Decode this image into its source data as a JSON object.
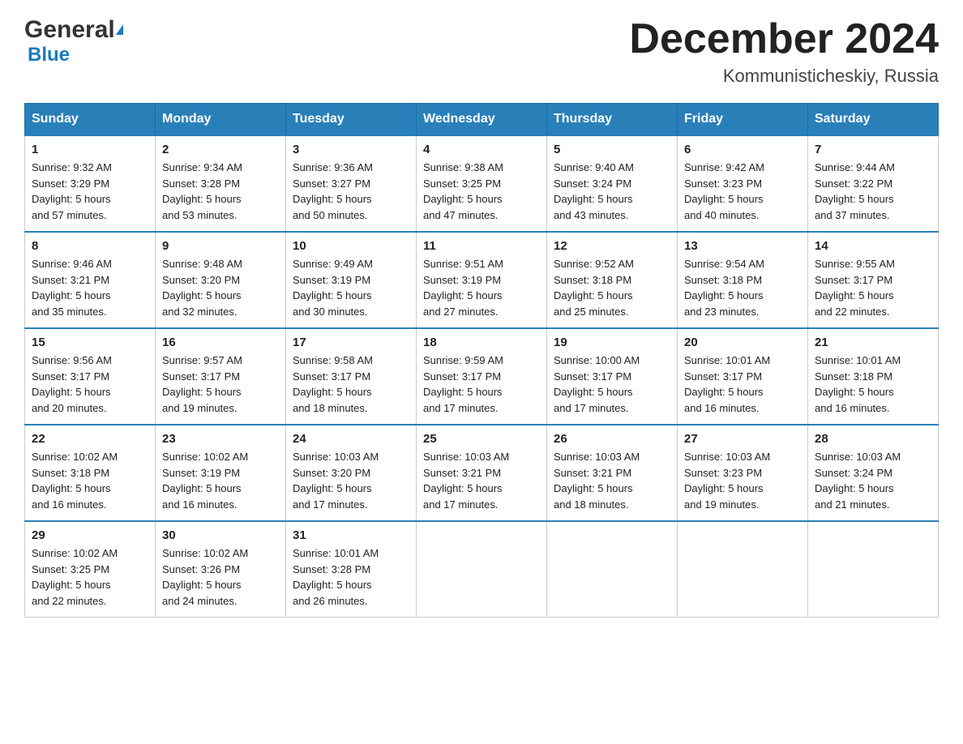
{
  "header": {
    "logo": {
      "general": "General",
      "blue": "Blue"
    },
    "title": "December 2024",
    "location": "Kommunisticheskiy, Russia"
  },
  "weekdays": [
    "Sunday",
    "Monday",
    "Tuesday",
    "Wednesday",
    "Thursday",
    "Friday",
    "Saturday"
  ],
  "weeks": [
    [
      {
        "day": "1",
        "sunrise": "9:32 AM",
        "sunset": "3:29 PM",
        "daylight": "5 hours and 57 minutes."
      },
      {
        "day": "2",
        "sunrise": "9:34 AM",
        "sunset": "3:28 PM",
        "daylight": "5 hours and 53 minutes."
      },
      {
        "day": "3",
        "sunrise": "9:36 AM",
        "sunset": "3:27 PM",
        "daylight": "5 hours and 50 minutes."
      },
      {
        "day": "4",
        "sunrise": "9:38 AM",
        "sunset": "3:25 PM",
        "daylight": "5 hours and 47 minutes."
      },
      {
        "day": "5",
        "sunrise": "9:40 AM",
        "sunset": "3:24 PM",
        "daylight": "5 hours and 43 minutes."
      },
      {
        "day": "6",
        "sunrise": "9:42 AM",
        "sunset": "3:23 PM",
        "daylight": "5 hours and 40 minutes."
      },
      {
        "day": "7",
        "sunrise": "9:44 AM",
        "sunset": "3:22 PM",
        "daylight": "5 hours and 37 minutes."
      }
    ],
    [
      {
        "day": "8",
        "sunrise": "9:46 AM",
        "sunset": "3:21 PM",
        "daylight": "5 hours and 35 minutes."
      },
      {
        "day": "9",
        "sunrise": "9:48 AM",
        "sunset": "3:20 PM",
        "daylight": "5 hours and 32 minutes."
      },
      {
        "day": "10",
        "sunrise": "9:49 AM",
        "sunset": "3:19 PM",
        "daylight": "5 hours and 30 minutes."
      },
      {
        "day": "11",
        "sunrise": "9:51 AM",
        "sunset": "3:19 PM",
        "daylight": "5 hours and 27 minutes."
      },
      {
        "day": "12",
        "sunrise": "9:52 AM",
        "sunset": "3:18 PM",
        "daylight": "5 hours and 25 minutes."
      },
      {
        "day": "13",
        "sunrise": "9:54 AM",
        "sunset": "3:18 PM",
        "daylight": "5 hours and 23 minutes."
      },
      {
        "day": "14",
        "sunrise": "9:55 AM",
        "sunset": "3:17 PM",
        "daylight": "5 hours and 22 minutes."
      }
    ],
    [
      {
        "day": "15",
        "sunrise": "9:56 AM",
        "sunset": "3:17 PM",
        "daylight": "5 hours and 20 minutes."
      },
      {
        "day": "16",
        "sunrise": "9:57 AM",
        "sunset": "3:17 PM",
        "daylight": "5 hours and 19 minutes."
      },
      {
        "day": "17",
        "sunrise": "9:58 AM",
        "sunset": "3:17 PM",
        "daylight": "5 hours and 18 minutes."
      },
      {
        "day": "18",
        "sunrise": "9:59 AM",
        "sunset": "3:17 PM",
        "daylight": "5 hours and 17 minutes."
      },
      {
        "day": "19",
        "sunrise": "10:00 AM",
        "sunset": "3:17 PM",
        "daylight": "5 hours and 17 minutes."
      },
      {
        "day": "20",
        "sunrise": "10:01 AM",
        "sunset": "3:17 PM",
        "daylight": "5 hours and 16 minutes."
      },
      {
        "day": "21",
        "sunrise": "10:01 AM",
        "sunset": "3:18 PM",
        "daylight": "5 hours and 16 minutes."
      }
    ],
    [
      {
        "day": "22",
        "sunrise": "10:02 AM",
        "sunset": "3:18 PM",
        "daylight": "5 hours and 16 minutes."
      },
      {
        "day": "23",
        "sunrise": "10:02 AM",
        "sunset": "3:19 PM",
        "daylight": "5 hours and 16 minutes."
      },
      {
        "day": "24",
        "sunrise": "10:03 AM",
        "sunset": "3:20 PM",
        "daylight": "5 hours and 17 minutes."
      },
      {
        "day": "25",
        "sunrise": "10:03 AM",
        "sunset": "3:21 PM",
        "daylight": "5 hours and 17 minutes."
      },
      {
        "day": "26",
        "sunrise": "10:03 AM",
        "sunset": "3:21 PM",
        "daylight": "5 hours and 18 minutes."
      },
      {
        "day": "27",
        "sunrise": "10:03 AM",
        "sunset": "3:23 PM",
        "daylight": "5 hours and 19 minutes."
      },
      {
        "day": "28",
        "sunrise": "10:03 AM",
        "sunset": "3:24 PM",
        "daylight": "5 hours and 21 minutes."
      }
    ],
    [
      {
        "day": "29",
        "sunrise": "10:02 AM",
        "sunset": "3:25 PM",
        "daylight": "5 hours and 22 minutes."
      },
      {
        "day": "30",
        "sunrise": "10:02 AM",
        "sunset": "3:26 PM",
        "daylight": "5 hours and 24 minutes."
      },
      {
        "day": "31",
        "sunrise": "10:01 AM",
        "sunset": "3:28 PM",
        "daylight": "5 hours and 26 minutes."
      },
      null,
      null,
      null,
      null
    ]
  ],
  "labels": {
    "sunrise": "Sunrise:",
    "sunset": "Sunset:",
    "daylight": "Daylight:"
  }
}
